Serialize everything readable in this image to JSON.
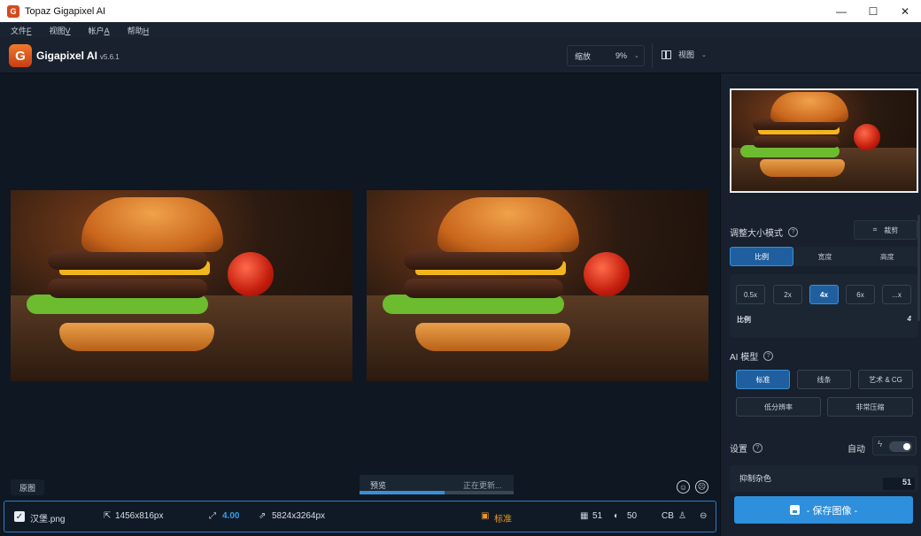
{
  "window": {
    "title": "Topaz Gigapixel AI",
    "app_icon_glyph": "G",
    "minimize": "—",
    "maximize": "☐",
    "close": "✕"
  },
  "menu": [
    {
      "label": "文件",
      "key": "F"
    },
    {
      "label": "视图",
      "key": "V"
    },
    {
      "label": "帐户",
      "key": "A"
    },
    {
      "label": "帮助",
      "key": "H"
    }
  ],
  "toolbar": {
    "logo_glyph": "G",
    "brand": "Gigapixel AI",
    "version": "v5.6.1",
    "zoom_label": "缩放",
    "zoom_value": "9%",
    "view_label": "视图"
  },
  "canvas": {
    "original_label": "原图",
    "preview_label": "预览",
    "updating_label": "正在更新...",
    "progress": 0.55,
    "face_icon_1": "☺",
    "face_icon_2": "☹"
  },
  "file": {
    "checked": "✓",
    "name": "汉堡.png",
    "source_size": "1456x816px",
    "scale": "4.00",
    "output_size": "5824x3264px",
    "model": "标准",
    "noise": "51",
    "blur": "50",
    "face": "CB"
  },
  "sidebar": {
    "resize_mode_label": "调整大小模式",
    "help_glyph": "?",
    "crop_label": "裁剪",
    "modes": [
      "比例",
      "宽度",
      "高度"
    ],
    "selected_mode": "比例",
    "scales": [
      "0.5x",
      "2x",
      "4x",
      "6x",
      "...x"
    ],
    "selected_scale": "4x",
    "scale_field_label": "比例",
    "scale_field_value": "4",
    "ai_model_label": "AI 模型",
    "models_row1": [
      "标准",
      "线条",
      "艺术 & CG"
    ],
    "models_row2": [
      "低分辨率",
      "非常压缩"
    ],
    "selected_model": "标准",
    "settings_label": "设置",
    "auto_label": "自动",
    "noise_label": "抑制杂色",
    "noise_value": "51",
    "save_label": "- 保存图像 -"
  },
  "colors": {
    "accent": "#2e8fdc",
    "selected": "#1f5fa0",
    "model_badge": "#e89a2a"
  }
}
